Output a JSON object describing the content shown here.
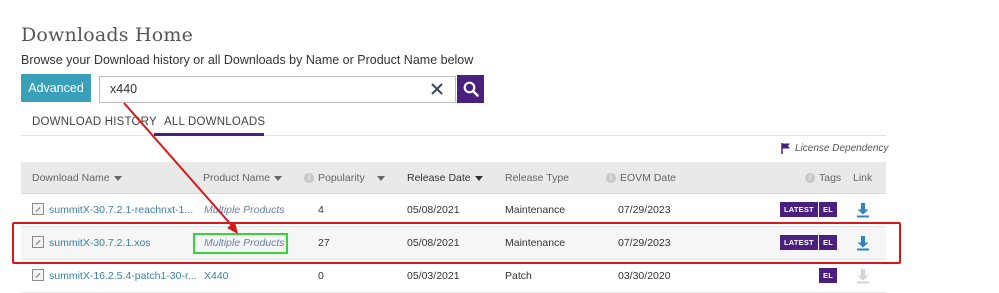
{
  "header": {
    "title": "Downloads Home",
    "subtitle": "Browse your Download history or all Downloads by Name or Product Name below"
  },
  "search": {
    "advanced_label": "Advanced",
    "value": "x440"
  },
  "tabs": [
    {
      "label": "DOWNLOAD HISTORY",
      "active": false
    },
    {
      "label": "ALL DOWNLOADS",
      "active": true
    }
  ],
  "license_dependency": "License Dependency",
  "columns": {
    "download_name": "Download Name",
    "product_name": "Product Name",
    "popularity": "Popularity",
    "release_date": "Release Date",
    "release_type": "Release Type",
    "eovm_date": "EOVM Date",
    "tags": "Tags",
    "link": "Link"
  },
  "rows": [
    {
      "name": "summitX-30.7.2.1-reachnxt-1...",
      "product": "Multiple Products",
      "popularity": "4",
      "release_date": "05/08/2021",
      "release_type": "Maintenance",
      "eovm_date": "07/29/2023",
      "tags": [
        "LATEST",
        "EL"
      ],
      "download_enabled": true
    },
    {
      "name": "summitX-30.7.2.1.xos",
      "product": "Multiple Products",
      "popularity": "27",
      "release_date": "05/08/2021",
      "release_type": "Maintenance",
      "eovm_date": "07/29/2023",
      "tags": [
        "LATEST",
        "EL"
      ],
      "download_enabled": true
    },
    {
      "name": "summitX-16.2.5.4-patch1-30-r...",
      "product": "X440",
      "popularity": "0",
      "release_date": "05/03/2021",
      "release_type": "Patch",
      "eovm_date": "03/30/2020",
      "tags": [
        "EL"
      ],
      "download_enabled": false
    }
  ],
  "colors": {
    "accent_purple": "#4b1f7e",
    "advanced_teal": "#3a9fb9",
    "annotation_red": "#d81818",
    "annotation_green": "#3ad13a"
  }
}
